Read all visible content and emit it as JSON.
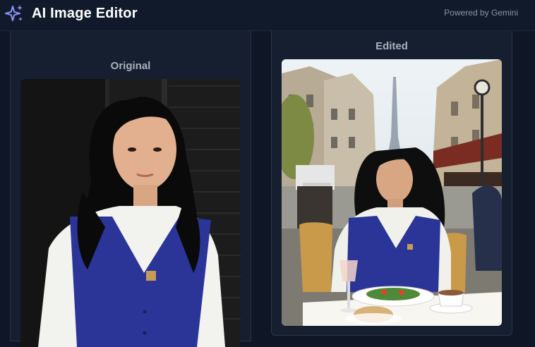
{
  "header": {
    "title": "AI Image Editor",
    "powered_by": "Powered by Gemini",
    "logo_icon": "sparkles-icon"
  },
  "panels": {
    "original": {
      "label": "Original"
    },
    "edited": {
      "label": "Edited"
    }
  },
  "colors": {
    "background": "#0f1726",
    "panel": "#161f30",
    "accent": "#8b93f8",
    "vest": "#2a3597"
  }
}
